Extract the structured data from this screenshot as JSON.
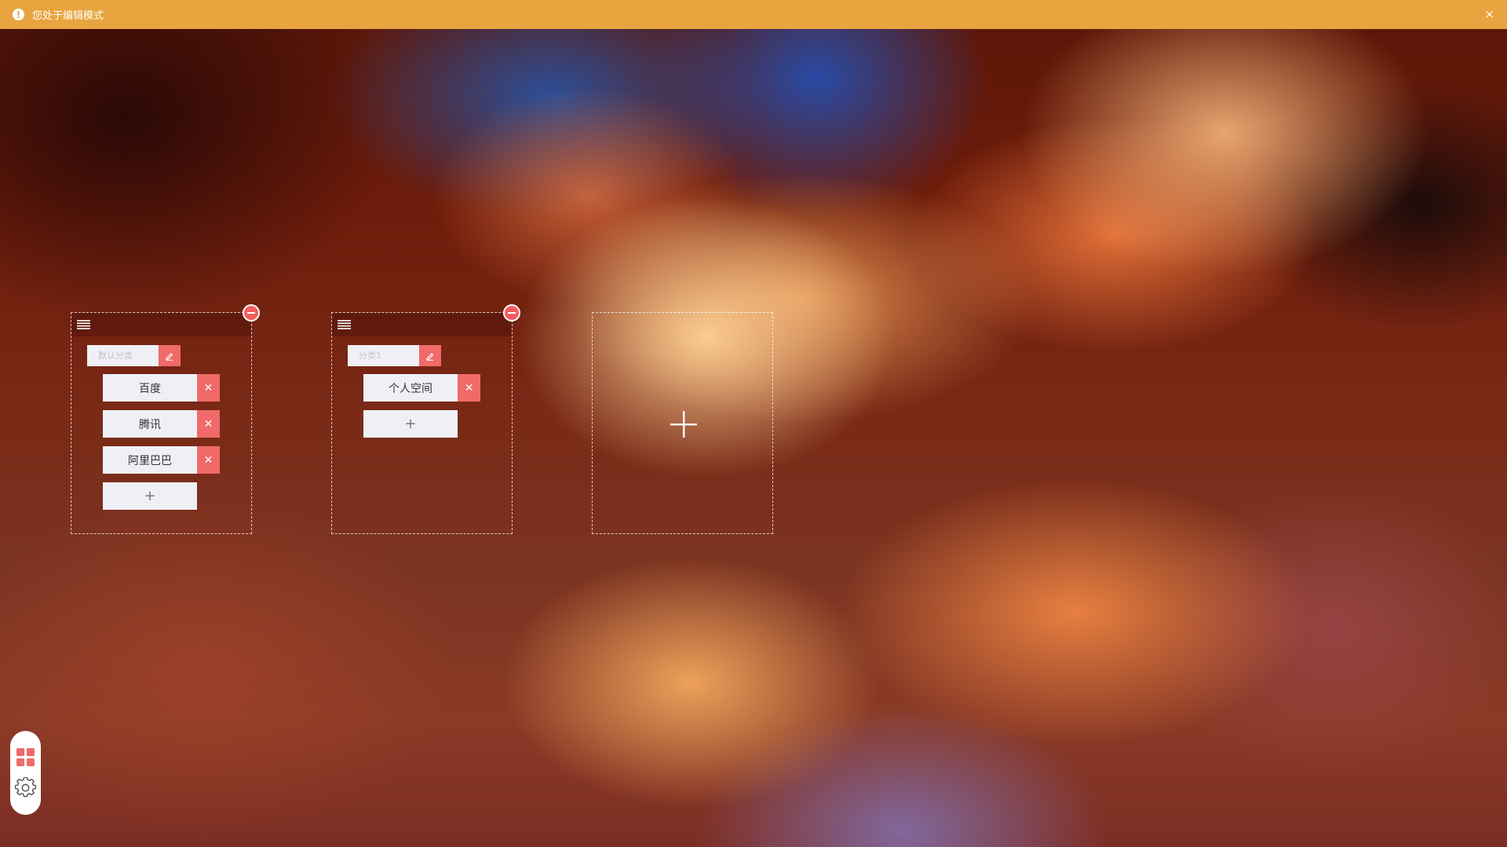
{
  "banner": {
    "icon": "exclamation-circle-icon",
    "icon_glyph": "!",
    "text": "您处于编辑模式",
    "close_glyph": "×",
    "color": "#e8a43e"
  },
  "groups": [
    {
      "category_value": "",
      "category_placeholder": "默认分类",
      "sites": [
        {
          "label": "百度"
        },
        {
          "label": "腾讯"
        },
        {
          "label": "阿里巴巴"
        }
      ]
    },
    {
      "category_value": "",
      "category_placeholder": "分类1",
      "sites": [
        {
          "label": "个人空间"
        }
      ]
    }
  ],
  "glyphs": {
    "delete": "✕",
    "add": "+"
  },
  "icons": {
    "drag": "menu-lines-icon",
    "remove_group": "minus-circle-icon",
    "edit": "pencil-icon",
    "add_group": "plus-icon",
    "dock_apps": "apps-grid-icon",
    "dock_settings": "gear-icon"
  },
  "colors": {
    "accent_red": "#f06a6a",
    "banner": "#e8a43e"
  }
}
